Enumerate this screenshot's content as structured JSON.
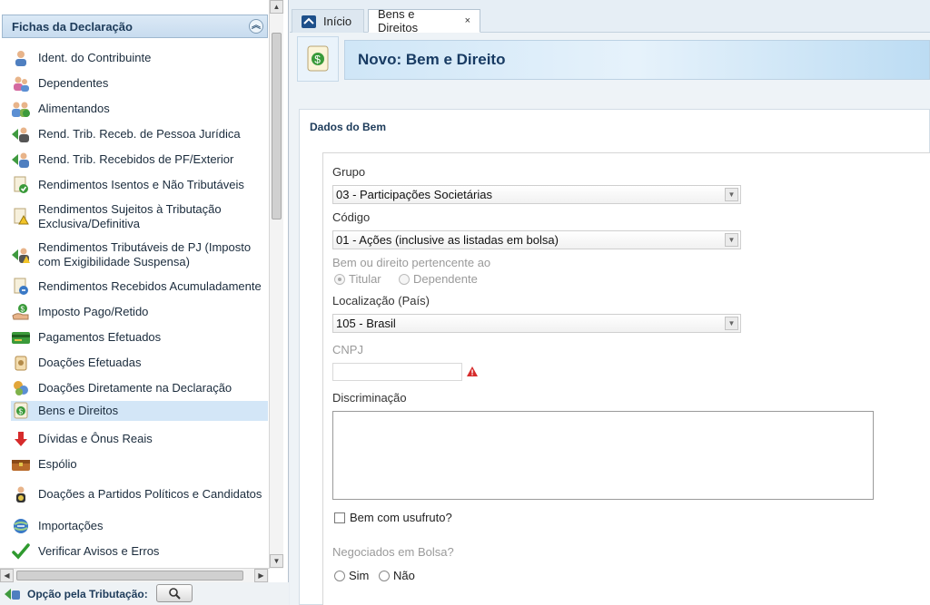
{
  "sidebar": {
    "title": "Fichas da Declaração",
    "items": [
      {
        "label": "Ident. do Contribuinte",
        "icon": "person-icon"
      },
      {
        "label": "Dependentes",
        "icon": "dependents-icon"
      },
      {
        "label": "Alimentandos",
        "icon": "alimony-people-icon"
      },
      {
        "label": "Rend. Trib. Receb. de Pessoa Jurídica",
        "icon": "income-company-icon"
      },
      {
        "label": "Rend. Trib. Recebidos de PF/Exterior",
        "icon": "income-person-icon"
      },
      {
        "label": "Rendimentos Isentos e Não Tributáveis",
        "icon": "exempt-income-icon"
      },
      {
        "label": "Rendimentos Sujeitos à Tributação Exclusiva/Definitiva",
        "icon": "exclusive-tax-icon"
      },
      {
        "label": "Rendimentos Tributáveis de PJ (Imposto com Exigibilidade Suspensa)",
        "icon": "suspended-tax-icon"
      },
      {
        "label": "Rendimentos Recebidos Acumuladamente",
        "icon": "accumulated-income-icon"
      },
      {
        "label": "Imposto Pago/Retido",
        "icon": "tax-paid-icon"
      },
      {
        "label": "Pagamentos Efetuados",
        "icon": "payments-icon"
      },
      {
        "label": "Doações Efetuadas",
        "icon": "donations-icon"
      },
      {
        "label": "Doações Diretamente na Declaração",
        "icon": "direct-donations-icon"
      },
      {
        "label": "Bens e Direitos",
        "icon": "assets-icon",
        "active": true
      },
      {
        "label": "Dívidas e Ônus Reais",
        "icon": "debts-icon"
      },
      {
        "label": "Espólio",
        "icon": "estate-icon"
      },
      {
        "label": "Doações a Partidos Políticos e Candidatos",
        "icon": "political-donations-icon"
      },
      {
        "label": "Importações",
        "icon": "imports-icon"
      },
      {
        "label": "Verificar Avisos e Erros",
        "icon": "check-errors-icon"
      }
    ]
  },
  "option_bar": {
    "label": "Opção pela Tributação:"
  },
  "tabs": [
    {
      "label": "Início",
      "icon": "home-icon"
    },
    {
      "label": "Bens e Direitos",
      "close": "×"
    }
  ],
  "page": {
    "title": "Novo: Bem e Direito"
  },
  "form": {
    "section_title": "Dados do Bem",
    "grupo_label": "Grupo",
    "grupo_value": "03 - Participações Societárias",
    "codigo_label": "Código",
    "codigo_value": "01 - Ações (inclusive as listadas em bolsa)",
    "pertence_label": "Bem ou direito pertencente ao",
    "titular_label": "Titular",
    "dependente_label": "Dependente",
    "localizacao_label": "Localização (País)",
    "localizacao_value": "105 - Brasil",
    "cnpj_label": "CNPJ",
    "cnpj_value": "",
    "discriminacao_label": "Discriminação",
    "discriminacao_value": "",
    "usufruto_label": "Bem com usufruto?",
    "bolsa_label": "Negociados em Bolsa?",
    "sim_label": "Sim",
    "nao_label": "Não"
  },
  "colors": {
    "accent": "#183b63",
    "active_row": "#d3e6f7",
    "error": "#d62b2b"
  }
}
